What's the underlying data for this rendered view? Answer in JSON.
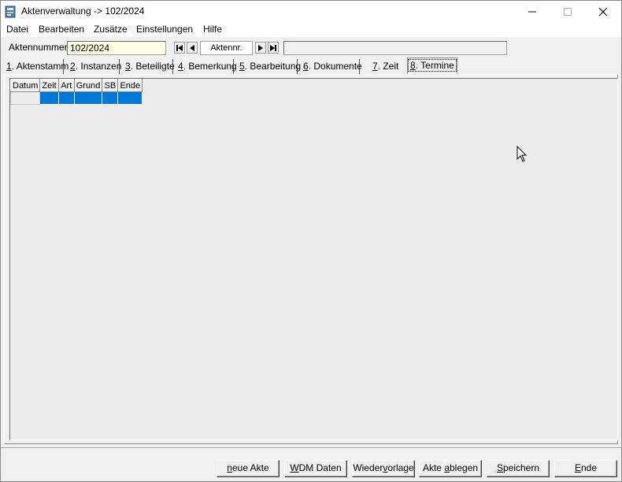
{
  "window": {
    "title": "Aktenverwaltung -> 102/2024",
    "icon": "app-icon"
  },
  "menu": [
    "Datei",
    "Bearbeiten",
    "Zusätze",
    "Einstellungen",
    "Hilfe"
  ],
  "nav": {
    "label": "Aktennummer :",
    "value": "102/2024",
    "search_label": "Aktennr."
  },
  "tabs": [
    {
      "key": "1",
      "rest": ". Aktenstamm"
    },
    {
      "key": "2",
      "rest": ". Instanzen"
    },
    {
      "key": "3",
      "rest": ". Beteiligte"
    },
    {
      "key": "4",
      "rest": ". Bemerkung"
    },
    {
      "key": "5",
      "rest": ". Bearbeitung"
    },
    {
      "key": "6",
      "rest": ". Dokumente"
    },
    {
      "key": "7",
      "rest": ". Zeit"
    },
    {
      "key": "8",
      "rest": ". Termine"
    }
  ],
  "active_tab": "8. Termine",
  "grid": {
    "columns": [
      "Datum",
      "Zeit",
      "Art",
      "Grund",
      "SB",
      "Ende"
    ],
    "selection_color": "#0078d7"
  },
  "buttons": {
    "neue_akte": {
      "pre": "",
      "key": "n",
      "post": "eue Akte"
    },
    "wdm_daten": {
      "pre": "",
      "key": "W",
      "post": "DM Daten"
    },
    "wiedervorlage": {
      "pre": "Wieder",
      "key": "v",
      "post": "orlage"
    },
    "akte_ablegen": {
      "pre": "Akte ",
      "key": "a",
      "post": "blegen"
    },
    "speichern": {
      "pre": "",
      "key": "S",
      "post": "peichern"
    },
    "ende": {
      "pre": "",
      "key": "E",
      "post": "nde"
    }
  }
}
